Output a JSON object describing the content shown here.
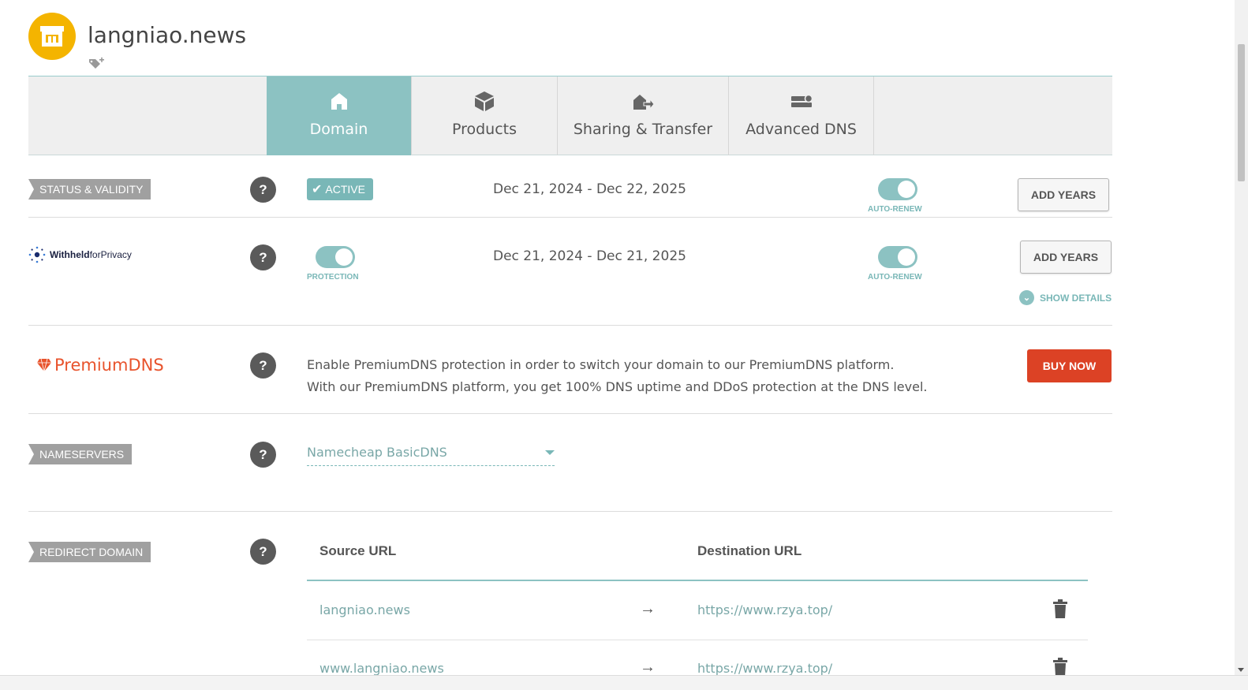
{
  "domain": {
    "name": "langniao.news"
  },
  "tabs": [
    {
      "label": "Domain",
      "icon": "home-icon",
      "active": true
    },
    {
      "label": "Products",
      "icon": "box-icon",
      "active": false
    },
    {
      "label": "Sharing & Transfer",
      "icon": "transfer-icon",
      "active": false
    },
    {
      "label": "Advanced DNS",
      "icon": "server-icon",
      "active": false
    }
  ],
  "status": {
    "label": "STATUS & VALIDITY",
    "badge": "ACTIVE",
    "dates": "Dec 21, 2024 - Dec 22, 2025",
    "auto_renew_caption": "AUTO-RENEW",
    "add_years": "ADD YEARS"
  },
  "privacy": {
    "logo_text_bold": "Withheld",
    "logo_text_rest": "forPrivacy",
    "protection_caption": "PROTECTION",
    "dates": "Dec 21, 2024 - Dec 21, 2025",
    "auto_renew_caption": "AUTO-RENEW",
    "add_years": "ADD YEARS",
    "show_details": "SHOW DETAILS"
  },
  "premium": {
    "logo_text": "PremiumDNS",
    "line1": "Enable PremiumDNS protection in order to switch your domain to our PremiumDNS platform.",
    "line2": "With our PremiumDNS platform, you get 100% DNS uptime and DDoS protection at the DNS level.",
    "buy": "BUY NOW"
  },
  "nameservers": {
    "label": "NAMESERVERS",
    "selected": "Namecheap BasicDNS"
  },
  "redirect": {
    "label": "REDIRECT DOMAIN",
    "source_header": "Source URL",
    "dest_header": "Destination URL",
    "arrow": "→",
    "rows": [
      {
        "source": "langniao.news",
        "destination": "https://www.rzya.top/"
      },
      {
        "source": "www.langniao.news",
        "destination": "https://www.rzya.top/"
      }
    ]
  },
  "colors": {
    "teal": "#8cc2c2",
    "buy": "#dc4225",
    "logo": "#f4b400"
  }
}
